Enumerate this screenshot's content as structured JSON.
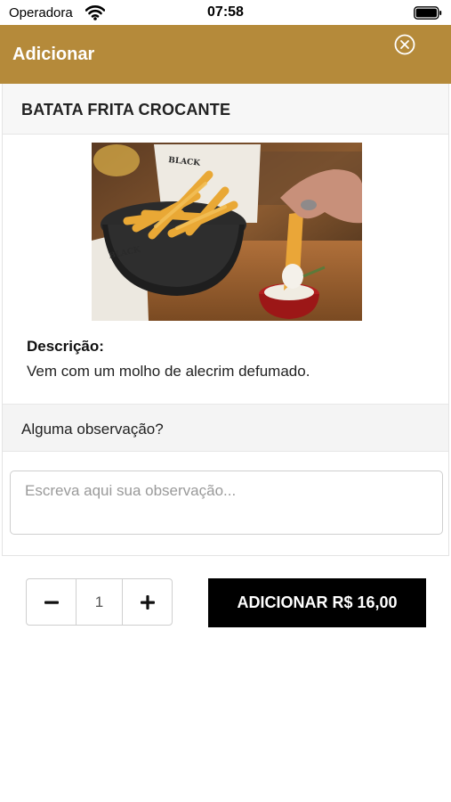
{
  "status_bar": {
    "carrier": "Operadora",
    "time": "07:58"
  },
  "header": {
    "title": "Adicionar",
    "close_icon": "close-circle-icon",
    "background_color": "#b58a3a"
  },
  "product": {
    "name": "BATATA FRITA CROCANTE",
    "description_label": "Descrição:",
    "description": "Vem com um molho de alecrim defumado."
  },
  "observation": {
    "label": "Alguma observação?",
    "placeholder": "Escreva aqui sua observação...",
    "value": ""
  },
  "quantity": {
    "value": "1",
    "decrement_icon": "minus-icon",
    "increment_icon": "plus-icon"
  },
  "add_button": {
    "label": "ADICIONAR R$ 16,00"
  }
}
